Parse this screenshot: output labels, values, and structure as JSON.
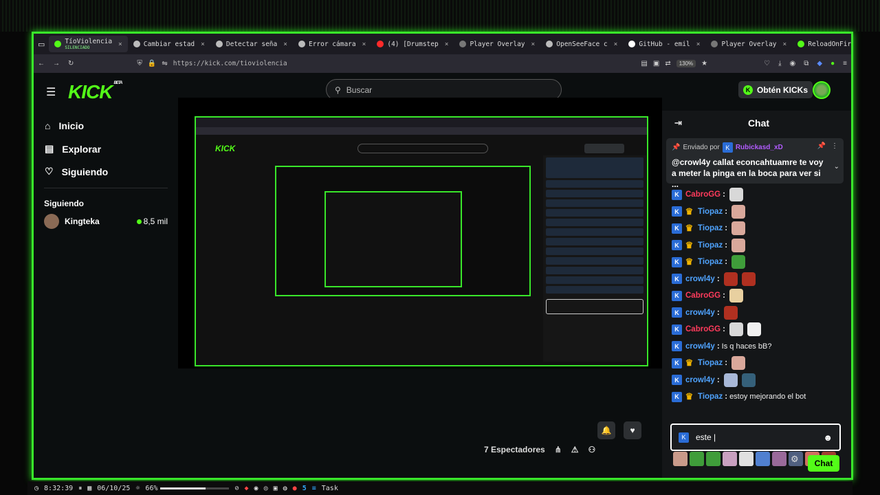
{
  "browser": {
    "tabs": [
      {
        "label": "TíoViolencia",
        "sub": "SILENCIADO",
        "active": true,
        "color": "#53fc18"
      },
      {
        "label": "Cambiar estad",
        "color": "#bbbbbb"
      },
      {
        "label": "Detectar seña",
        "color": "#bbbbbb"
      },
      {
        "label": "Error cámara",
        "color": "#bbbbbb"
      },
      {
        "label": "(4) [Drumstep",
        "color": "#ff2a2a"
      },
      {
        "label": "Player Overlay",
        "color": "#777777"
      },
      {
        "label": "OpenSeeFace c",
        "color": "#bbbbbb"
      },
      {
        "label": "GitHub - emil",
        "color": "#ffffff"
      },
      {
        "label": "Player Overlay",
        "color": "#777777"
      },
      {
        "label": "ReloadOnFire",
        "color": "#53fc18"
      },
      {
        "label": "Player Overlay",
        "color": "#777777"
      }
    ],
    "new_tab": "+",
    "url": "https://kick.com/tioviolencia",
    "zoom": "130%"
  },
  "header": {
    "logo": "KICK",
    "logo_badge": "BETA",
    "search_placeholder": "Buscar",
    "kicks_label": "Obtén KICKs"
  },
  "sidebar": {
    "nav": [
      {
        "label": "Inicio",
        "icon": "home-icon"
      },
      {
        "label": "Explorar",
        "icon": "browse-icon"
      },
      {
        "label": "Siguiendo",
        "icon": "heart-icon"
      }
    ],
    "following_title": "Siguiendo",
    "following": [
      {
        "name": "Kingteka",
        "viewers": "8,5 mil"
      }
    ]
  },
  "stream": {
    "viewers": "7 Espectadores"
  },
  "chat": {
    "title": "Chat",
    "pinned": {
      "prefix": "Enviado por",
      "author": "Rubickasd_xD",
      "text": "@crowl4y callat econcahtuamre te voy a meter la pinga en la boca para ver si ..."
    },
    "messages": [
      {
        "user": "CabroGG",
        "color": "#ff3b5c",
        "crown": false,
        "text": "",
        "emotes": [
          "#d8d8d8"
        ]
      },
      {
        "user": "Tiopaz",
        "color": "#4fa3ff",
        "crown": true,
        "text": "",
        "emotes": [
          "#d9a89b"
        ]
      },
      {
        "user": "Tiopaz",
        "color": "#4fa3ff",
        "crown": true,
        "text": "",
        "emotes": [
          "#d9a89b"
        ]
      },
      {
        "user": "Tiopaz",
        "color": "#4fa3ff",
        "crown": true,
        "text": "",
        "emotes": [
          "#d9a89b"
        ]
      },
      {
        "user": "Tiopaz",
        "color": "#4fa3ff",
        "crown": true,
        "text": "",
        "emotes": [
          "#3f9d3a"
        ]
      },
      {
        "user": "crowl4y",
        "color": "#4fa3ff",
        "crown": false,
        "text": "",
        "emotes": [
          "#b03020",
          "#b03020"
        ]
      },
      {
        "user": "CabroGG",
        "color": "#ff3b5c",
        "crown": false,
        "text": "",
        "emotes": [
          "#e8d0a0"
        ]
      },
      {
        "user": "crowl4y",
        "color": "#4fa3ff",
        "crown": false,
        "text": "",
        "emotes": [
          "#b03020"
        ]
      },
      {
        "user": "CabroGG",
        "color": "#ff3b5c",
        "crown": false,
        "text": "",
        "emotes": [
          "#d8d8d8",
          "#f0f0f0"
        ]
      },
      {
        "user": "crowl4y",
        "color": "#4fa3ff",
        "crown": false,
        "text": "Is q haces bB?",
        "emotes": []
      },
      {
        "user": "Tiopaz",
        "color": "#4fa3ff",
        "crown": true,
        "text": "",
        "emotes": [
          "#d9a89b"
        ]
      },
      {
        "user": "crowl4y",
        "color": "#4fa3ff",
        "crown": false,
        "text": "",
        "emotes": [
          "#a8b8d8",
          "#35607a"
        ]
      },
      {
        "user": "Tiopaz",
        "color": "#4fa3ff",
        "crown": true,
        "text": "estoy mejorando el bot",
        "emotes": []
      }
    ],
    "emote_strip": [
      "#c99a8a",
      "#3f9d3a",
      "#3f9d3a",
      "#c9a0c0",
      "#e0e0e0",
      "#5080d0",
      "#9a6a9a",
      "#506080",
      "#d07060",
      "#a04030"
    ],
    "input_value": "este |",
    "send_label": "Chat"
  },
  "taskbar": {
    "clock": "8:32:39",
    "date": "06/10/25",
    "volume": "66%",
    "volume_level": 0.66,
    "workspace": "5",
    "task": "Task"
  }
}
